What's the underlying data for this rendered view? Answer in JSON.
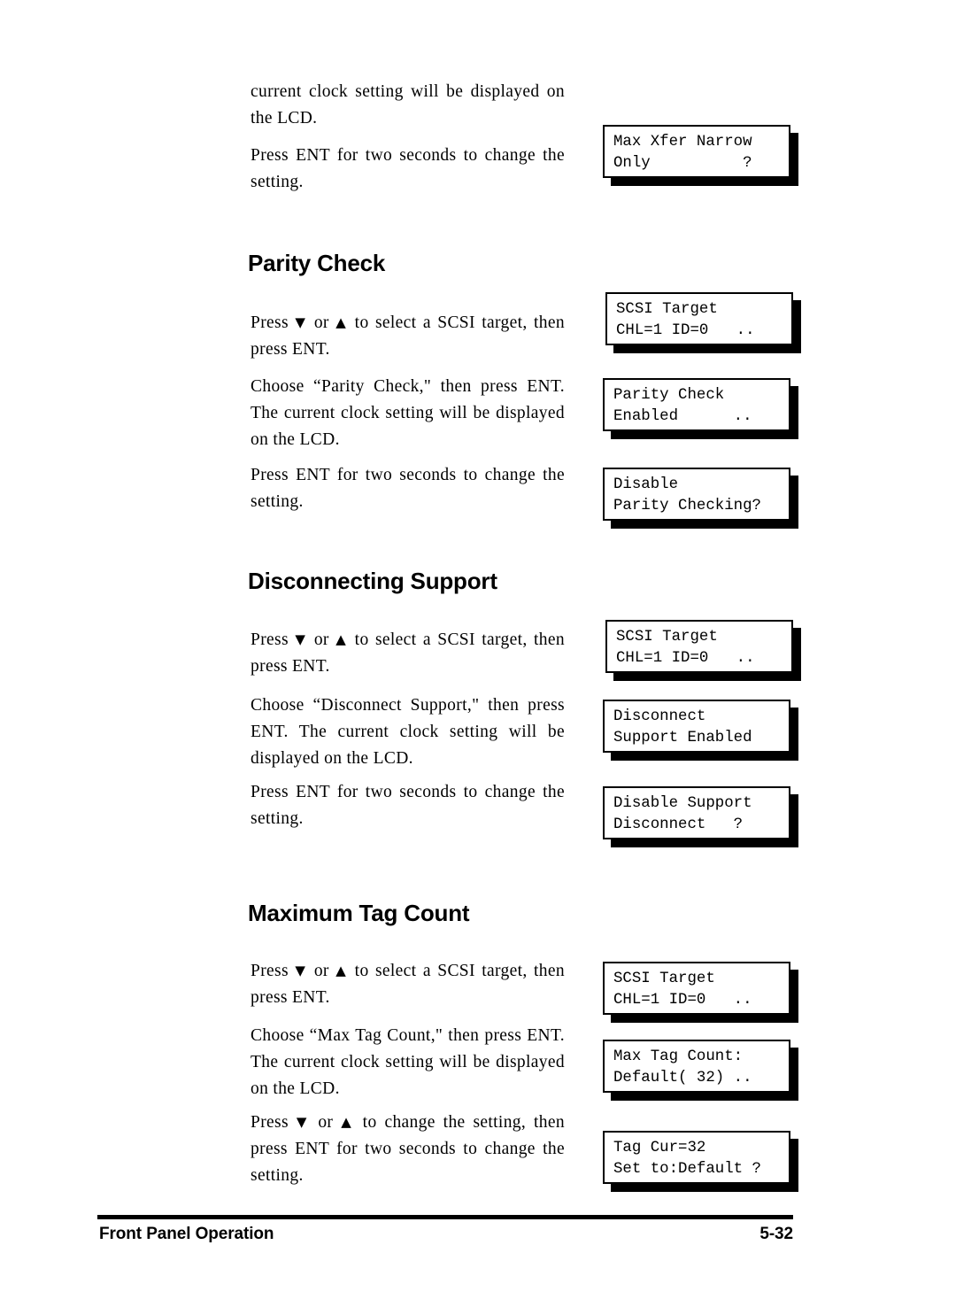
{
  "document": {
    "footer": {
      "left_label": "Front Panel Operation",
      "page_number": "5-32"
    }
  },
  "intro": {
    "paragraph_1": "current clock setting will be displayed on the LCD.",
    "paragraph_2": "Press ENT for two seconds to change the setting."
  },
  "sections": [
    {
      "heading": "Parity Check",
      "paragraphs": [
        {
          "prefix": "Press ",
          "icon_down": "▼",
          "mid": " or ",
          "icon_up": "▲",
          "suffix": " to select a SCSI target, then press ENT."
        },
        {
          "text": "Choose “Parity Check,\" then press ENT. The current clock setting will be displayed on the LCD."
        },
        {
          "text": "Press ENT for two seconds to change the setting."
        }
      ]
    },
    {
      "heading": "Disconnecting Support",
      "paragraphs": [
        {
          "prefix": "Press ",
          "icon_down": "▼",
          "mid": " or ",
          "icon_up": "▲",
          "suffix": " to select a SCSI target, then press ENT."
        },
        {
          "text": "Choose “Disconnect Support,\" then press ENT. The current clock setting will be displayed on the LCD."
        },
        {
          "text": "Press ENT for two seconds to change the setting."
        }
      ]
    },
    {
      "heading": "Maximum Tag Count",
      "paragraphs": [
        {
          "prefix": "Press ",
          "icon_down": "▼",
          "mid": " or ",
          "icon_up": "▲",
          "suffix": " to select a SCSI target, then press ENT."
        },
        {
          "text": "Choose “Max Tag Count,\" then press ENT.  The current clock setting will be displayed on the LCD."
        },
        {
          "prefix": "Press ",
          "icon_down": "▼",
          "mid": " or ",
          "icon_up": "▲",
          "suffix": " to change the setting, then press ENT for two seconds to change the setting."
        }
      ]
    }
  ],
  "lcd_panels": [
    {
      "id": "max-xfer-narrow-only",
      "line1": "Max Xfer Narrow",
      "line2": "Only          ?"
    },
    {
      "id": "scsi-target-parity",
      "line1": "SCSI Target",
      "line2": "CHL=1 ID=0   .."
    },
    {
      "id": "parity-check-enabled",
      "line1": "Parity Check",
      "line2": "Enabled      .."
    },
    {
      "id": "disable-parity-checking",
      "line1": "Disable",
      "line2": "Parity Checking?"
    },
    {
      "id": "scsi-target-disconnect",
      "line1": "SCSI Target",
      "line2": "CHL=1 ID=0   .."
    },
    {
      "id": "disconnect-support-enabled",
      "line1": "Disconnect",
      "line2": "Support Enabled"
    },
    {
      "id": "disable-support-disconnect",
      "line1": "Disable Support",
      "line2": "Disconnect   ?"
    },
    {
      "id": "scsi-target-tag",
      "line1": "SCSI Target",
      "line2": "CHL=1 ID=0   .."
    },
    {
      "id": "max-tag-count-default",
      "line1": "Max Tag Count:",
      "line2": "Default( 32) .."
    },
    {
      "id": "tag-cur-set-default",
      "line1": "Tag Cur=32",
      "line2": "Set to:Default ?"
    }
  ]
}
